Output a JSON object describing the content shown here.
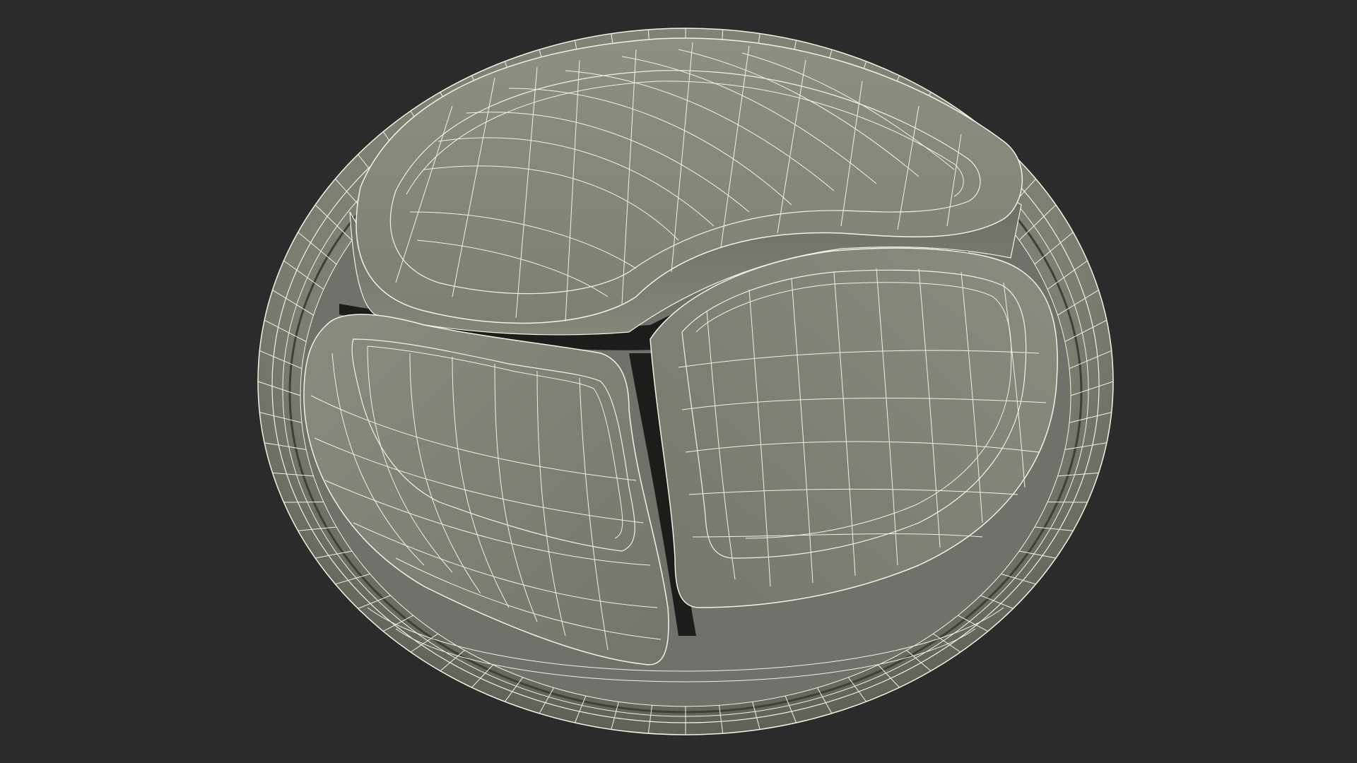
{
  "scene": {
    "subject": "valve-wireframe-model",
    "colors": {
      "background": "#2b2b2b",
      "surface_light": "#8a8b7f",
      "surface_mid": "#7b7c70",
      "surface_dark": "#5c5d54",
      "shadow": "#1c1c1a",
      "wire": "#f2f2e4"
    }
  }
}
